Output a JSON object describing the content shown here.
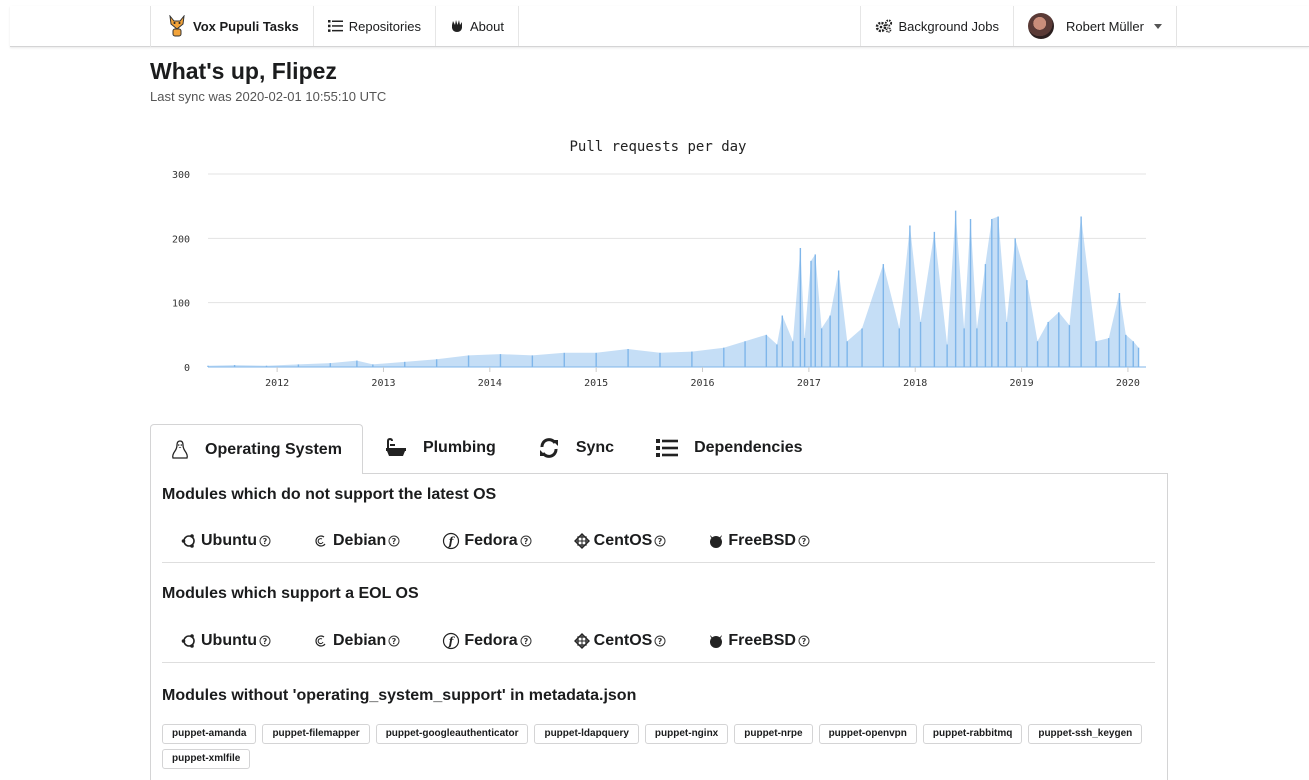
{
  "nav": {
    "brand": "Vox Pupuli Tasks",
    "repositories": "Repositories",
    "about": "About",
    "background_jobs": "Background Jobs",
    "user": "Robert Müller"
  },
  "header": {
    "title": "What's up, Flipez",
    "last_sync": "Last sync was 2020-02-01 10:55:10 UTC"
  },
  "colors": {
    "series": "#7fb6ea",
    "grid": "#e3e3e3"
  },
  "chart_data": {
    "type": "area",
    "title": "Pull requests per day",
    "xlabel": "",
    "ylabel": "",
    "y_ticks": [
      "0",
      "100",
      "200",
      "300"
    ],
    "ylim": [
      0,
      300
    ],
    "x_ticks": [
      "2012",
      "2013",
      "2014",
      "2015",
      "2016",
      "2017",
      "2018",
      "2019",
      "2020"
    ],
    "xlim": [
      2011.35,
      2020.17
    ],
    "grid": true,
    "legend": "none",
    "series": [
      {
        "x": [
          2011.35,
          2011.6,
          2011.9,
          2012.2,
          2012.5,
          2012.75,
          2012.9,
          2013.2,
          2013.5,
          2013.8,
          2014.1,
          2014.4,
          2014.7,
          2015.0,
          2015.3,
          2015.6,
          2015.9,
          2016.2,
          2016.4,
          2016.6,
          2016.7,
          2016.75,
          2016.85,
          2016.92,
          2016.96,
          2017.02,
          2017.06,
          2017.12,
          2017.2,
          2017.28,
          2017.36,
          2017.5,
          2017.7,
          2017.85,
          2017.95,
          2018.05,
          2018.18,
          2018.3,
          2018.38,
          2018.46,
          2018.52,
          2018.58,
          2018.66,
          2018.72,
          2018.78,
          2018.86,
          2018.94,
          2019.05,
          2019.15,
          2019.25,
          2019.35,
          2019.45,
          2019.56,
          2019.7,
          2019.82,
          2019.92,
          2019.98,
          2020.05,
          2020.1
        ],
        "y": [
          2,
          3,
          2,
          4,
          6,
          10,
          4,
          8,
          12,
          18,
          20,
          18,
          22,
          22,
          28,
          22,
          24,
          30,
          40,
          50,
          35,
          80,
          40,
          185,
          45,
          165,
          175,
          60,
          80,
          150,
          40,
          60,
          160,
          60,
          220,
          70,
          210,
          35,
          243,
          60,
          230,
          60,
          160,
          230,
          234,
          70,
          200,
          135,
          40,
          70,
          85,
          65,
          234,
          40,
          45,
          115,
          50,
          40,
          30
        ]
      }
    ]
  },
  "tabs": [
    {
      "label": "Operating System"
    },
    {
      "label": "Plumbing"
    },
    {
      "label": "Sync"
    },
    {
      "label": "Dependencies"
    }
  ],
  "sections": {
    "unsupported_latest": "Modules which do not support the latest OS",
    "eol": "Modules which support a EOL OS",
    "no_metadata": "Modules without 'operating_system_support' in metadata.json"
  },
  "os_list": [
    "Ubuntu",
    "Debian",
    "Fedora",
    "CentOS",
    "FreeBSD"
  ],
  "modules": [
    "puppet-amanda",
    "puppet-filemapper",
    "puppet-googleauthenticator",
    "puppet-ldapquery",
    "puppet-nginx",
    "puppet-nrpe",
    "puppet-openvpn",
    "puppet-rabbitmq",
    "puppet-ssh_keygen",
    "puppet-xmlfile"
  ]
}
